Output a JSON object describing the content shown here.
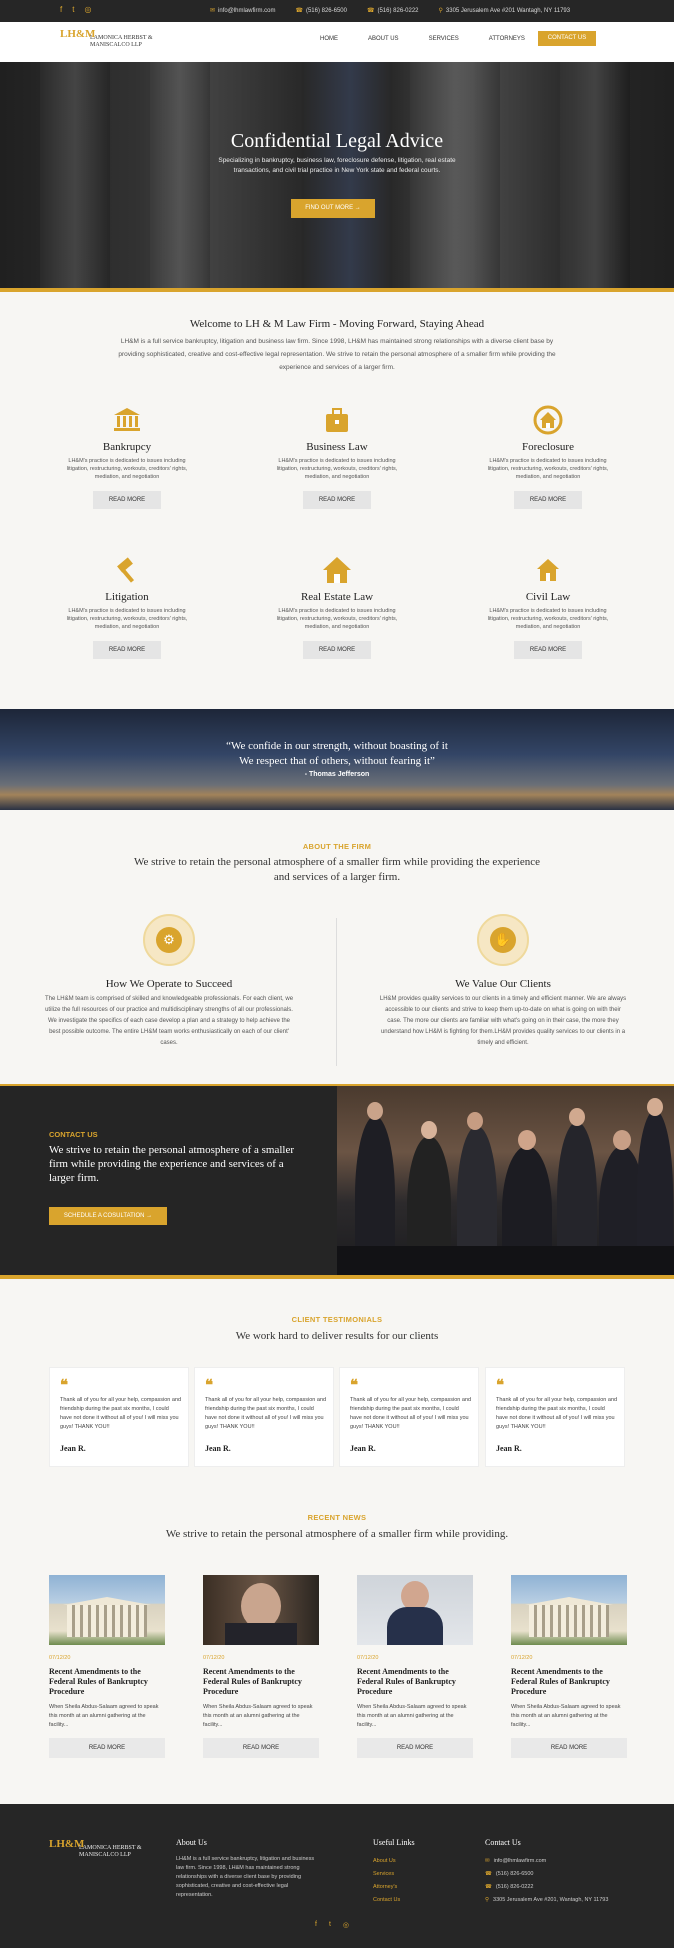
{
  "topbar": {
    "social": [
      "f",
      "t",
      "◎"
    ],
    "email": "info@lhmlawfirm.com",
    "phone1": "(516) 826-6500",
    "phone2": "(516) 826-0222",
    "address": "3305 Jerusalem Ave #201 Wantagh, NY 11793"
  },
  "header": {
    "logo_mark": "LH&M",
    "logo_name": "LAMONICA HERBST & MANISCALCO LLP",
    "nav": [
      "HOME",
      "ABOUT US",
      "SERVICES",
      "ATTORNEYS"
    ],
    "cta": "CONTACT US"
  },
  "hero": {
    "title": "Confidential Legal Advice",
    "text": "Specializing in bankruptcy, business law, foreclosure defense, litigation, real estate transactions, and civil trial practice in New York state and federal courts.",
    "button": "FIND OUT MORE →"
  },
  "welcome": {
    "title": "Welcome to LH & M Law Firm - Moving Forward, Staying Ahead",
    "text": "LH&M is a full service bankruptcy, litigation and business law firm. Since 1998, LH&M has maintained strong relationships with a diverse client base by providing sophisticated, creative and cost-effective legal representation. We strive to retain the personal atmosphere of a smaller firm while providing the experience and services of a larger firm."
  },
  "services": [
    {
      "title": "Bankrupcy",
      "icon": "bank-icon",
      "glyph": "🏛",
      "text": "LH&M's practice is dedicated to issues including litigation, restructuring, workouts, creditors' rights, mediation, and negotiation",
      "button": "READ MORE"
    },
    {
      "title": "Business Law",
      "icon": "briefcase-icon",
      "glyph": "💼",
      "text": "LH&M's practice is dedicated to issues including litigation, restructuring, workouts, creditors' rights, mediation, and negotiation",
      "button": "READ MORE"
    },
    {
      "title": "Foreclosure",
      "icon": "house-circle-icon",
      "glyph": "⌂",
      "text": "LH&M's practice is dedicated to issues including litigation, restructuring, workouts, creditors' rights, mediation, and negotiation",
      "button": "READ MORE"
    },
    {
      "title": "Litigation",
      "icon": "gavel-icon",
      "glyph": "⚖",
      "text": "LH&M's practice is dedicated to issues including litigation, restructuring, workouts, creditors' rights, mediation, and negotiation",
      "button": "READ MORE"
    },
    {
      "title": "Real Estate Law",
      "icon": "home-icon",
      "glyph": "⌂",
      "text": "LH&M's practice is dedicated to issues including litigation, restructuring, workouts, creditors' rights, mediation, and negotiation",
      "button": "READ MORE"
    },
    {
      "title": "Civil Law",
      "icon": "house-icon",
      "glyph": "⌂",
      "text": "LH&M's practice is dedicated to issues including litigation, restructuring, workouts, creditors' rights, mediation, and negotiation",
      "button": "READ MORE"
    }
  ],
  "quote": {
    "line1": "“We confide in our strength, without boasting of it",
    "line2": "We respect that of others, without fearing it”",
    "author": "- Thomas Jefferson"
  },
  "about": {
    "eyebrow": "ABOUT THE FIRM",
    "headline": "We strive to retain the personal atmosphere of a smaller firm while providing the experience and services of a larger firm.",
    "left": {
      "title": "How We Operate to Succeed",
      "text": "The LH&M team is comprised of skilled and knowledgeable professionals. For each client, we utilize the full resources of our practice and multidisciplinary strengths of all our professionals. We investigate the specifics of each case develop a plan and a strategy to help achieve the best possible outcome. The entire LH&M team works enthusiastically on each of our client' cases."
    },
    "right": {
      "title": "We Value Our Clients",
      "text": "LH&M provides quality services to our clients in a timely and efficient manner. We are always accessible to our clients and strive to keep them up-to-date on what is going on with their case. The more our clients are familiar with what's going on in their case, the more they understand how LH&M is fighting for them.LH&M provides quality services to our clients in a timely and efficient."
    }
  },
  "contact": {
    "eyebrow": "CONTACT US",
    "text": "We strive to retain the personal atmosphere of a smaller firm while providing the experience and services of a larger firm.",
    "button": "SCHEDULE A COSULTATION →"
  },
  "testimonials": {
    "eyebrow": "CLIENT TESTIMONIALS",
    "headline": "We work hard to deliver results for our clients",
    "items": [
      {
        "text": "Thank all of you for all your help, compassion and friendship during the past six months, I could have not done it without all of you! I will miss you guys! THANK YOU!!",
        "name": "Jean R."
      },
      {
        "text": "Thank all of you for all your help, compassion and friendship during the past six months, I could have not done it without all of you! I will miss you guys! THANK YOU!!",
        "name": "Jean R."
      },
      {
        "text": "Thank all of you for all your help, compassion and friendship during the past six months, I could have not done it without all of you! I will miss you guys! THANK YOU!!",
        "name": "Jean R."
      },
      {
        "text": "Thank all of you for all your help, compassion and friendship during the past six months, I could have not done it without all of you! I will miss you guys! THANK YOU!!",
        "name": "Jean R."
      }
    ]
  },
  "news": {
    "eyebrow": "RECENT NEWS",
    "headline": "We strive to retain the personal atmosphere of a smaller firm while providing.",
    "items": [
      {
        "date": "07/12/20",
        "title": "Recent Amendments to the Federal Rules of Bankruptcy Procedure",
        "text": "When Sheila Abdus-Salaam agreed to speak this month at an alumni gathering at the facility...",
        "button": "READ MORE"
      },
      {
        "date": "07/12/20",
        "title": "Recent Amendments to the Federal Rules of Bankruptcy Procedure",
        "text": "When Sheila Abdus-Salaam agreed to speak this month at an alumni gathering at the facility...",
        "button": "READ MORE"
      },
      {
        "date": "07/12/20",
        "title": "Recent Amendments to the Federal Rules of Bankruptcy Procedure",
        "text": "When Sheila Abdus-Salaam agreed to speak this month at an alumni gathering at the facility...",
        "button": "READ MORE"
      },
      {
        "date": "07/12/20",
        "title": "Recent Amendments to the Federal Rules of Bankruptcy Procedure",
        "text": "When Sheila Abdus-Salaam agreed to speak this month at an alumni gathering at the facility...",
        "button": "READ MORE"
      }
    ]
  },
  "footer": {
    "about_title": "About Us",
    "about_text": "LH&M is a full service bankruptcy, litigation and business law firm. Since 1998, LH&M has maintained strong relationships with a diverse client base by providing sophisticated, creative and cost-effective legal representation.",
    "links_title": "Useful Links",
    "links": [
      "About Us",
      "Services",
      "Attorney's",
      "Contact Us"
    ],
    "contact_title": "Contact Us",
    "email": "info@lhmlawfirm.com",
    "phone1": "(516) 826-6500",
    "phone2": "(516) 826-0222",
    "address": "3305 Jerusalem Ave #201, Wantagh, NY 11793",
    "social": [
      "f",
      "t",
      "◎"
    ]
  },
  "colors": {
    "accent": "#d9a42d",
    "dark": "#262626",
    "light": "#f7f6f3"
  }
}
